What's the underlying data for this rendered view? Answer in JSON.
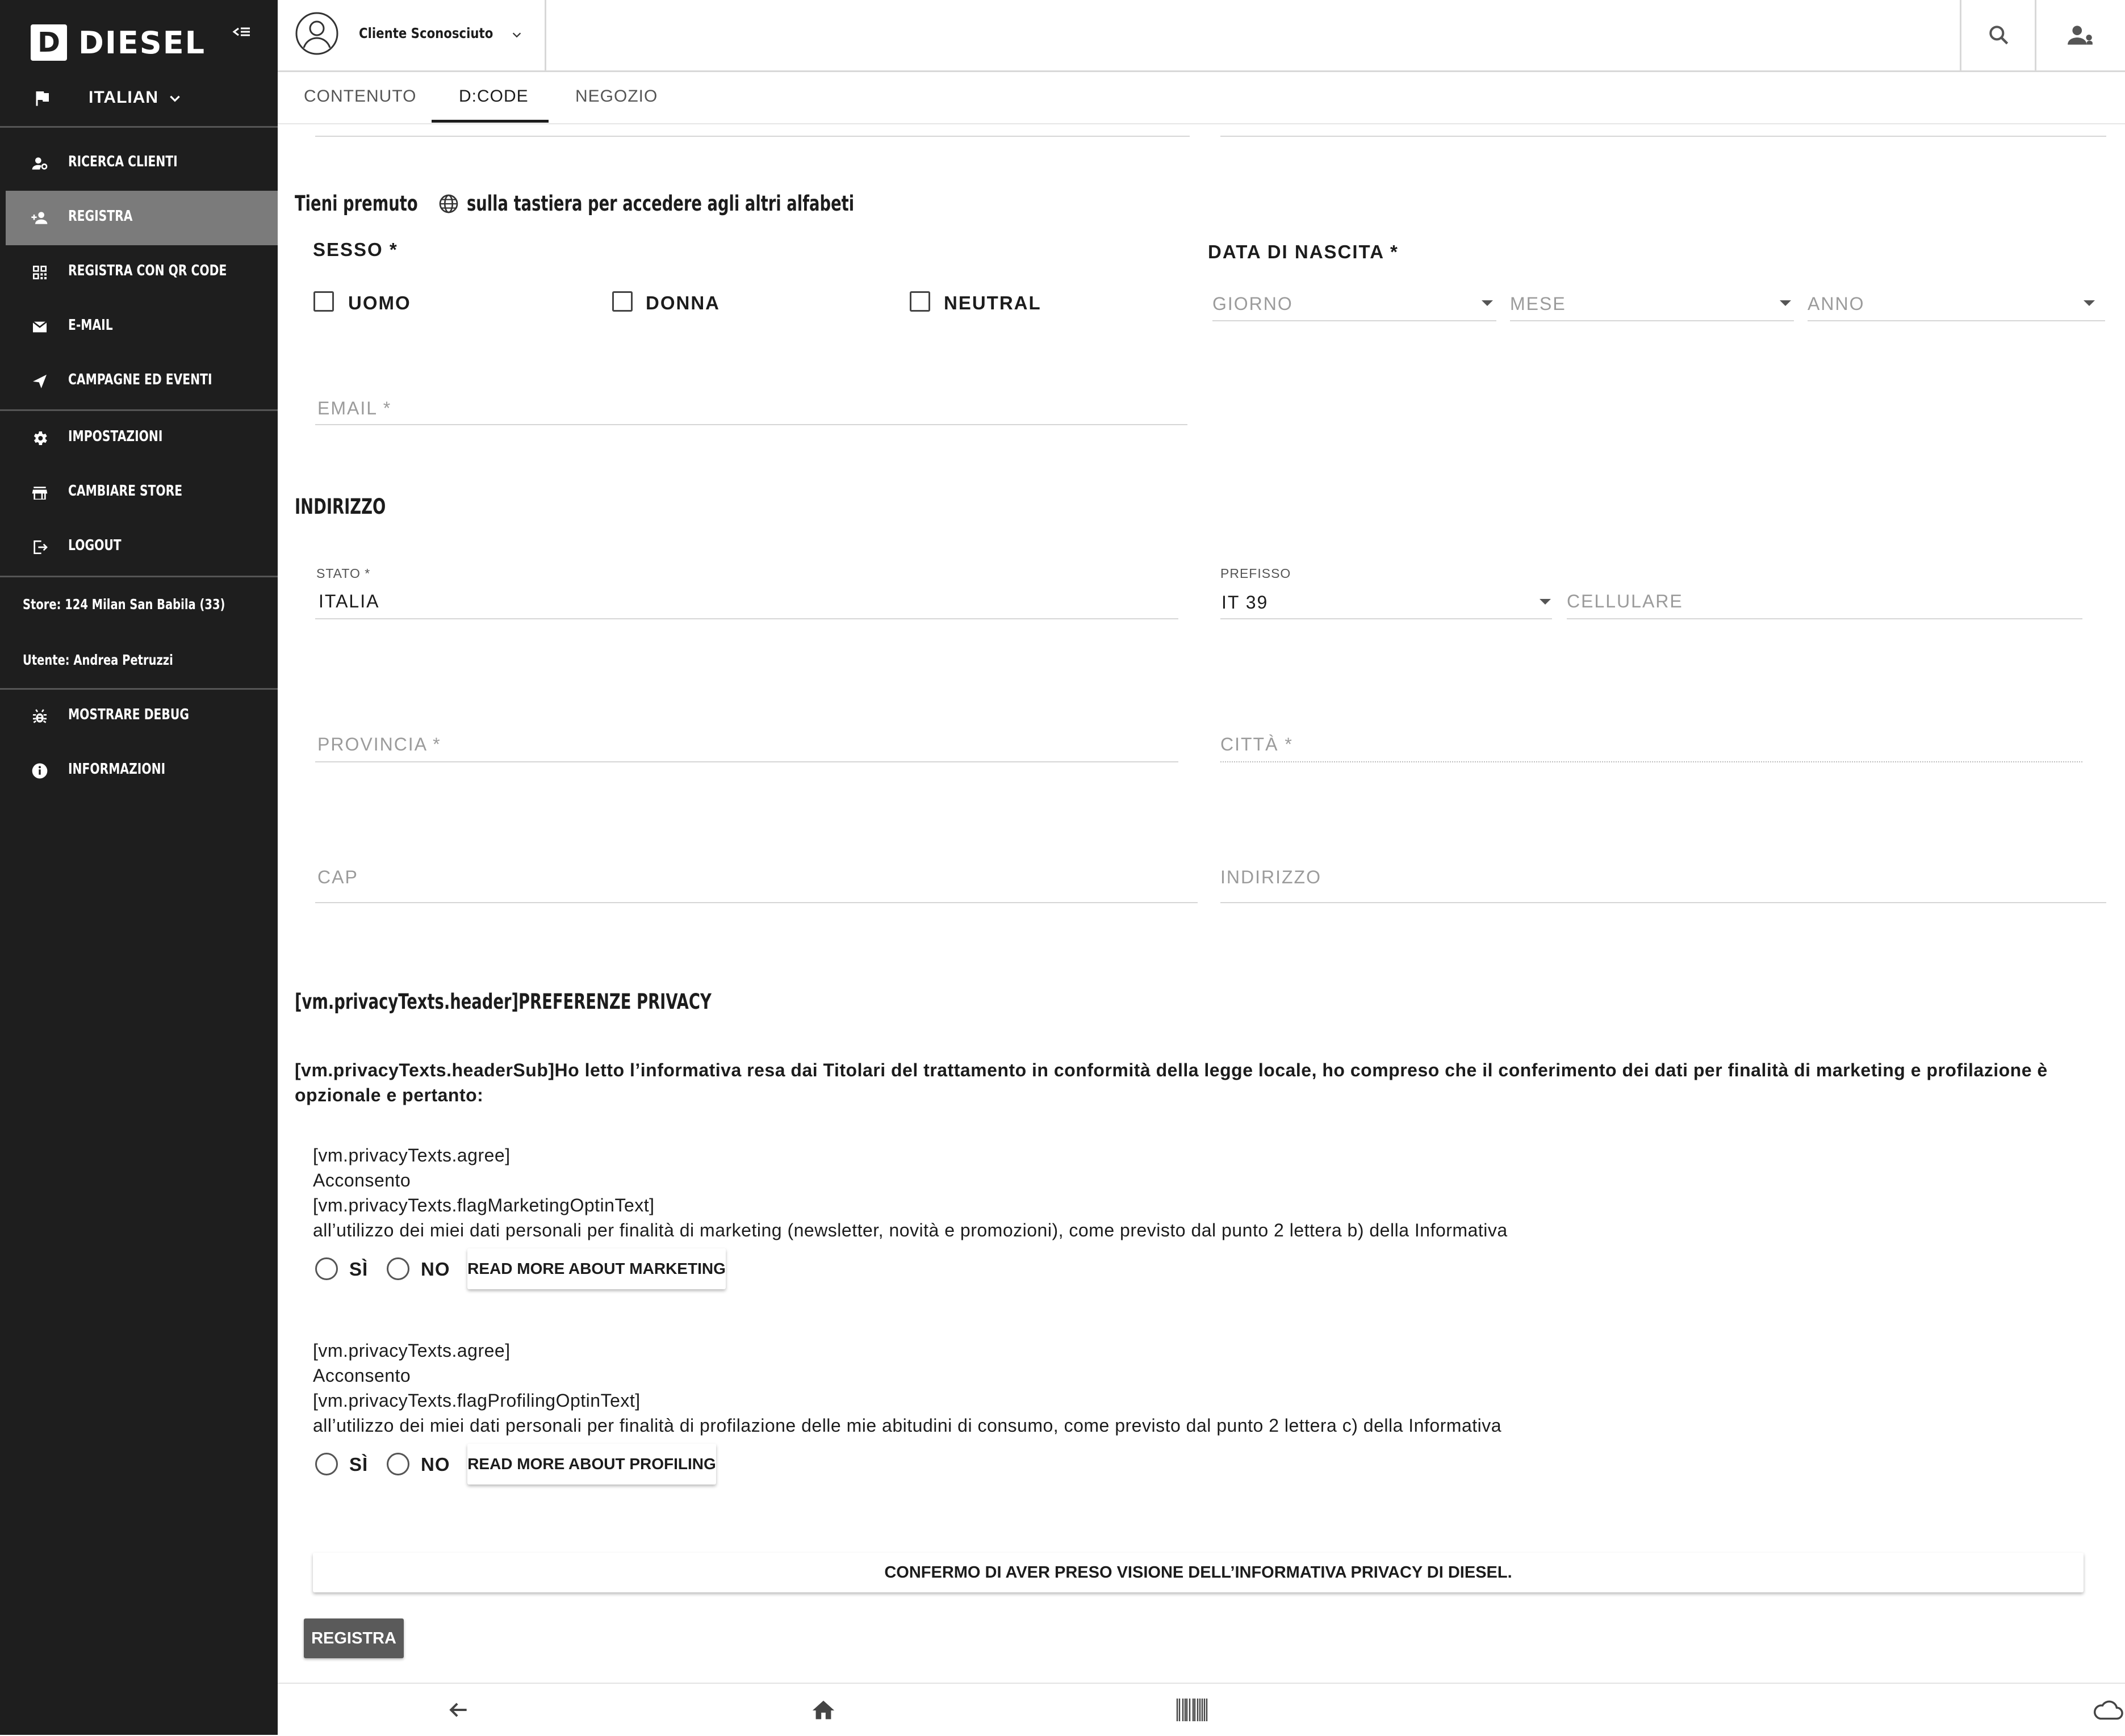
{
  "brand": {
    "logo_letter": "D",
    "logo_text": "DIESEL"
  },
  "sidebar": {
    "language": "ITALIAN",
    "items": [
      {
        "label": "RICERCA CLIENTI",
        "icon": "person-search-icon"
      },
      {
        "label": "REGISTRA",
        "icon": "person-add-icon",
        "active": true
      },
      {
        "label": "REGISTRA CON QR CODE",
        "icon": "qr-code-icon"
      },
      {
        "label": "E-MAIL",
        "icon": "mail-icon"
      },
      {
        "label": "CAMPAGNE ED EVENTI",
        "icon": "send-icon"
      },
      {
        "label": "IMPOSTAZIONI",
        "icon": "gear-icon"
      },
      {
        "label": "CAMBIARE STORE",
        "icon": "store-icon"
      },
      {
        "label": "LOGOUT",
        "icon": "logout-icon"
      },
      {
        "label": "MOSTRARE DEBUG",
        "icon": "bug-icon"
      },
      {
        "label": "INFORMAZIONI",
        "icon": "info-icon"
      }
    ],
    "store": "Store: 124 Milan San Babila (33)",
    "user": "Utente: Andrea Petruzzi"
  },
  "header": {
    "client_name": "Cliente Sconosciuto"
  },
  "tabs": [
    {
      "label": "CONTENUTO"
    },
    {
      "label": "D:CODE",
      "active": true
    },
    {
      "label": "NEGOZIO"
    }
  ],
  "form": {
    "keyboard_hint_before": "Tieni premuto",
    "keyboard_hint_after": "sulla tastiera per accedere agli altri alfabeti",
    "gender": {
      "label": "SESSO *",
      "options": [
        "UOMO",
        "DONNA",
        "NEUTRAL"
      ]
    },
    "birth": {
      "label": "DATA DI NASCITA *",
      "day": "GIORNO",
      "month": "MESE",
      "year": "ANNO"
    },
    "email_placeholder": "EMAIL *",
    "address_section": "INDIRIZZO",
    "state_label": "STATO *",
    "state_value": "ITALIA",
    "prefix_label": "PREFISSO",
    "prefix_value": "IT 39",
    "mobile_placeholder": "CELLULARE",
    "province_placeholder": "PROVINCIA *",
    "city_placeholder": "CITTÀ *",
    "zip_placeholder": "CAP",
    "street_placeholder": "INDIRIZZO"
  },
  "privacy": {
    "header": "[vm.privacyTexts.header]PREFERENZE PRIVACY",
    "sub_line1": "[vm.privacyTexts.headerSub]Ho letto l’informativa resa dai Titolari del trattamento in conformità della legge locale, ho compreso che il conferimento dei dati per finalità di marketing e profilazione è",
    "sub_line2": "opzionale e pertanto:",
    "marketing": {
      "lines": [
        "[vm.privacyTexts.agree]",
        "Acconsento",
        "[vm.privacyTexts.flagMarketingOptinText]",
        "all’utilizzo dei miei dati personali per finalità di marketing (newsletter, novità e promozioni), come previsto dal punto 2 lettera b) della Informativa"
      ],
      "yes": "SÌ",
      "no": "NO",
      "read_more": "READ MORE ABOUT MARKETING"
    },
    "profiling": {
      "lines": [
        "[vm.privacyTexts.agree]",
        "Acconsento",
        "[vm.privacyTexts.flagProfilingOptinText]",
        "all’utilizzo dei miei dati personali per finalità di profilazione delle mie abitudini di consumo, come previsto dal punto 2 lettera c) della Informativa"
      ],
      "yes": "SÌ",
      "no": "NO",
      "read_more": "READ MORE ABOUT PROFILING"
    },
    "confirm_button": "CONFERMO DI AVER PRESO VISIONE DELL’INFORMATIVA PRIVACY DI DIESEL."
  },
  "submit_button": "REGISTRA",
  "bottombar": {
    "icons": [
      "back-arrow-icon",
      "home-icon",
      "barcode-icon",
      "cloud-icon"
    ]
  },
  "colors": {
    "sidebar_bg": "#1e1e1e",
    "sidebar_active": "#7b7b7b",
    "submit_bg": "#5a5a5a"
  }
}
